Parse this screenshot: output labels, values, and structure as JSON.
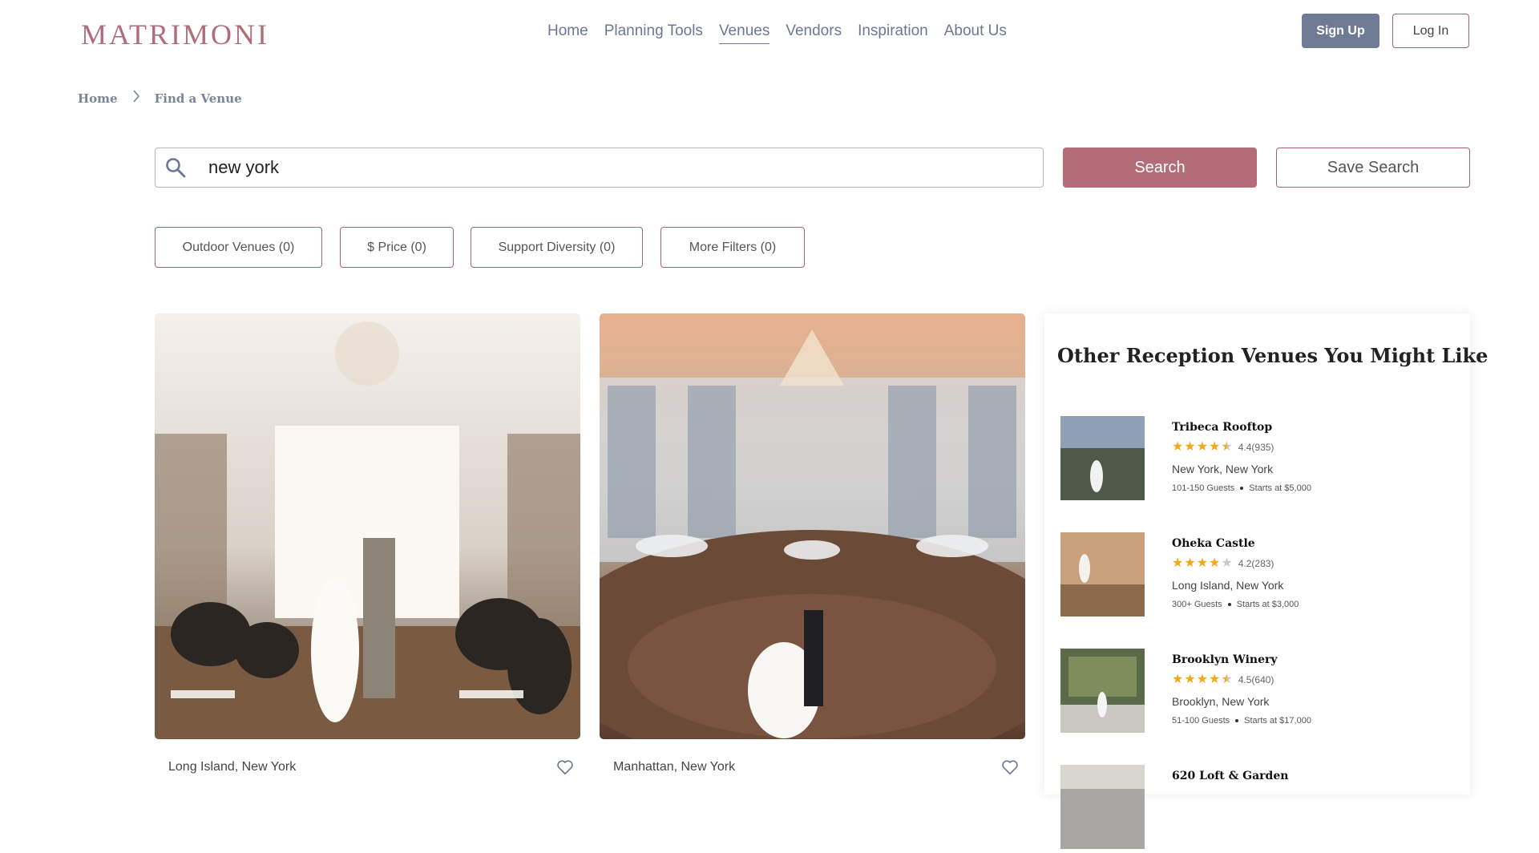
{
  "brand": {
    "logo_text": "MATRIMONI",
    "accent": "#b26d78",
    "nav_color": "#6b7895"
  },
  "nav": {
    "items": [
      "Home",
      "Planning Tools",
      "Venues",
      "Vendors",
      "Inspiration",
      "About Us"
    ],
    "active": "Venues"
  },
  "auth": {
    "signup_label": "Sign Up",
    "login_label": "Log In"
  },
  "breadcrumb": {
    "home": "Home",
    "current": "Find a Venue"
  },
  "search": {
    "value": "new york",
    "button_label": "Search",
    "save_label": "Save Search"
  },
  "filters": [
    "Outdoor Venues (0)",
    "$ Price (0)",
    "Support Diversity (0)",
    "More Filters (0)"
  ],
  "venues": [
    {
      "location": "Long Island, New York"
    },
    {
      "location": "Manhattan, New York"
    }
  ],
  "sidebar": {
    "title": "Other Reception Venues You Might Like",
    "items": [
      {
        "name": "Tribeca Rooftop",
        "rating": 4.4,
        "rating_text": "4.4(935)",
        "location": "New York, New York",
        "guests": "101-150 Guests",
        "price": "Starts at $5,000"
      },
      {
        "name": "Oheka Castle",
        "rating": 4.2,
        "rating_text": "4.2(283)",
        "location": "Long Island, New York",
        "guests": "300+ Guests",
        "price": "Starts at $3,000"
      },
      {
        "name": "Brooklyn Winery",
        "rating": 4.5,
        "rating_text": "4.5(640)",
        "location": "Brooklyn, New York",
        "guests": "51-100 Guests",
        "price": "Starts at $17,000"
      },
      {
        "name": "620 Loft & Garden"
      }
    ]
  }
}
